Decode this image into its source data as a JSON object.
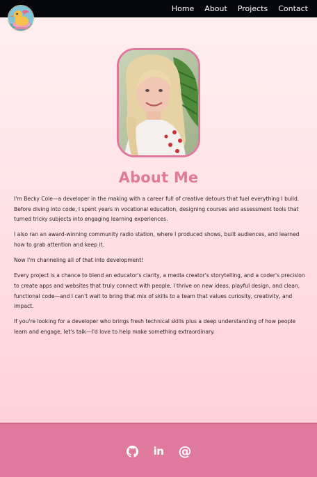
{
  "nav": {
    "logo_icon": "duck-logo-icon",
    "links": [
      "Home",
      "About",
      "Projects",
      "Contact"
    ]
  },
  "about": {
    "heading": "About Me",
    "paragraphs": [
      "I'm Becky Cole—a developer in the making with a career full of creative detours that fuel everything I build. Before diving into code, I spent years in vocational education, designing courses and assessment tools that turned tricky subjects into engaging learning experiences.",
      "I also ran an award-winning community radio station, where I produced shows, built audiences, and learned how to grab attention and keep it.",
      "Now I'm channeling all of that into development!",
      "Every project is a chance to blend an educator's clarity, a media creator's storytelling, and a coder's precision to create apps and websites that truly connect with people. I thrive on new ideas, playful design, and clean, functional code—and I can't wait to bring that mix of skills to a team that values curiosity, creativity, and impact.",
      "If you're looking for a developer who brings fresh technical skills plus a deep understanding of how people learn and engage, let's talk—I'd love to help make something extraordinary."
    ]
  },
  "footer": {
    "icons": [
      "github-icon",
      "linkedin-icon",
      "email-icon"
    ],
    "linkedin_text": "in",
    "email_text": "@"
  },
  "colors": {
    "nav_bg": "#07080e",
    "accent": "#e07a9c",
    "footer_bg": "#df7a9e",
    "page_bg_top": "#fff0f1",
    "page_bg_bottom": "#ffd2da"
  }
}
